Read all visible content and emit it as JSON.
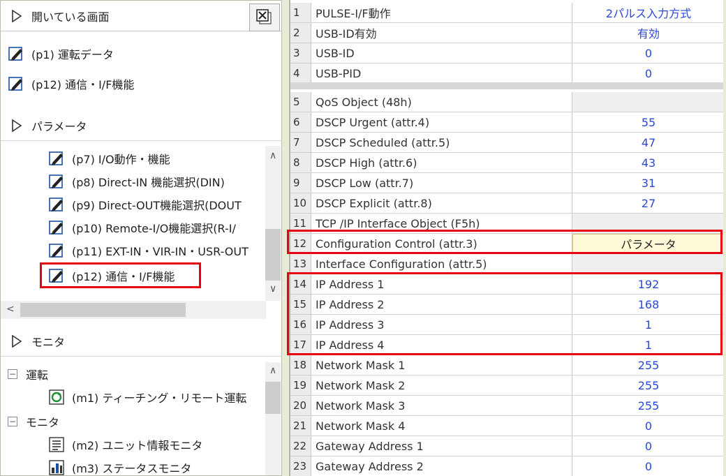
{
  "left_panel": {
    "open_screens": {
      "title": "開いている画面",
      "items": [
        {
          "label": "(p1) 運転データ"
        },
        {
          "label": "(p12) 通信・I/F機能"
        }
      ]
    },
    "parameters": {
      "title": "パラメータ",
      "items": [
        {
          "label": "(p7) I/O動作・機能"
        },
        {
          "label": "(p8) Direct-IN 機能選択(DIN)"
        },
        {
          "label": "(p9) Direct-OUT機能選択(DOUT"
        },
        {
          "label": "(p10) Remote-I/O機能選択(R-I/"
        },
        {
          "label": "(p11) EXT-IN・VIR-IN・USR-OUT"
        },
        {
          "label": "(p12) 通信・I/F機能"
        }
      ]
    },
    "monitor": {
      "title": "モニタ",
      "groups": [
        {
          "label": "運転",
          "children": [
            {
              "label": "(m1) ティーチング・リモート運転"
            }
          ]
        },
        {
          "label": "モニタ",
          "children": [
            {
              "label": "(m2) ユニット情報モニタ"
            },
            {
              "label": "(m3) ステータスモニタ"
            }
          ]
        }
      ]
    }
  },
  "table": {
    "rows": [
      {
        "no": "1",
        "name": "PULSE-I/F動作",
        "value": "2パルス入力方式"
      },
      {
        "no": "2",
        "name": "USB-ID有効",
        "value": "有効"
      },
      {
        "no": "3",
        "name": "USB-ID",
        "value": "0"
      },
      {
        "no": "4",
        "name": "USB-PID",
        "value": "0"
      },
      {
        "no": "5",
        "name": "QoS Object (48h)",
        "value": ""
      },
      {
        "no": "6",
        "name": "DSCP Urgent (attr.4)",
        "value": "55"
      },
      {
        "no": "7",
        "name": "DSCP Scheduled (attr.5)",
        "value": "47"
      },
      {
        "no": "8",
        "name": "DSCP High (attr.6)",
        "value": "43"
      },
      {
        "no": "9",
        "name": "DSCP Low (attr.7)",
        "value": "31"
      },
      {
        "no": "10",
        "name": "DSCP Explicit (attr.8)",
        "value": "27"
      },
      {
        "no": "11",
        "name": "TCP /IP Interface Object (F5h)",
        "value": ""
      },
      {
        "no": "12",
        "name": "Configuration Control (attr.3)",
        "value": "パラメータ"
      },
      {
        "no": "13",
        "name": "Interface Configuration (attr.5)",
        "value": ""
      },
      {
        "no": "14",
        "name": "IP Address 1",
        "value": "192"
      },
      {
        "no": "15",
        "name": "IP Address 2",
        "value": "168"
      },
      {
        "no": "16",
        "name": "IP Address 3",
        "value": "1"
      },
      {
        "no": "17",
        "name": "IP Address 4",
        "value": "1"
      },
      {
        "no": "18",
        "name": "Network Mask 1",
        "value": "255"
      },
      {
        "no": "19",
        "name": "Network Mask 2",
        "value": "255"
      },
      {
        "no": "20",
        "name": "Network Mask 3",
        "value": "255"
      },
      {
        "no": "21",
        "name": "Network Mask 4",
        "value": "0"
      },
      {
        "no": "22",
        "name": "Gateway Address 1",
        "value": "0"
      },
      {
        "no": "23",
        "name": "Gateway Address 2",
        "value": "0"
      }
    ]
  },
  "colors": {
    "highlight": "#e60012",
    "value_text": "#2a48d8"
  }
}
